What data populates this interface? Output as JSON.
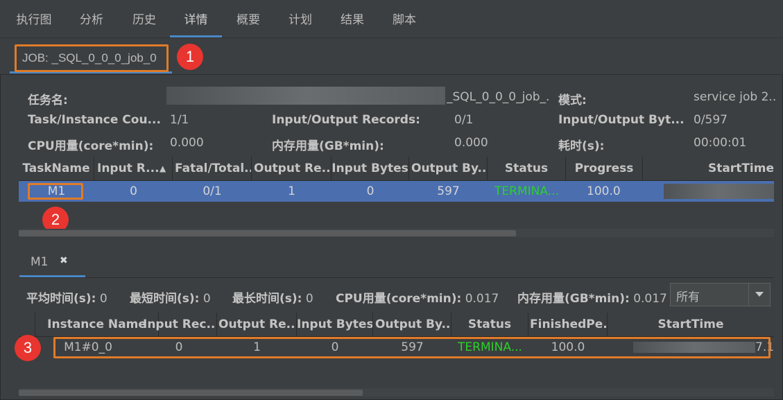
{
  "top_tabs": [
    "执行图",
    "分析",
    "历史",
    "详情",
    "概要",
    "计划",
    "结果",
    "脚本"
  ],
  "active_top_tab": "详情",
  "job_tab": {
    "label": "JOB: _SQL_0_0_0_job_0"
  },
  "markers": [
    "1",
    "2",
    "3"
  ],
  "job_info": {
    "task_name_label": "任务名:",
    "task_name_value": "_SQL_0_0_0_job_.",
    "mode_label": "模式:",
    "mode_value": "service job 2..",
    "task_count_label": "Task/Instance Cou...",
    "task_count_value": "1/1",
    "io_records_label": "Input/Output Records:",
    "io_records_value": "0/1",
    "io_bytes_label": "Input/Output Byt...",
    "io_bytes_value": "0/597",
    "cpu_label": "CPU用量(core*min):",
    "cpu_value": "0.000",
    "mem_label": "内存用量(GB*min):",
    "mem_value": "0.000",
    "time_label": "耗时(s):",
    "time_value": "00:00:01"
  },
  "task_table": {
    "columns": [
      "TaskName",
      "Input R...",
      "Fatal/Total...",
      "Output Re...",
      "Input Bytes",
      "Output By...",
      "Status",
      "Progress",
      "StartTime"
    ],
    "sort_indicator": "▲",
    "rows": [
      {
        "name": "M1",
        "input_records": "0",
        "fatal_total": "0/1",
        "output_records": "1",
        "input_bytes": "0",
        "output_bytes": "597",
        "status": "TERMINA...",
        "progress": "100.0"
      }
    ]
  },
  "detail_tab": {
    "label": "M1",
    "close": "✖"
  },
  "instance_stats": {
    "avg_label": "平均时间(s):",
    "avg_value": "0",
    "min_label": "最短时间(s):",
    "min_value": "0",
    "max_label": "最长时间(s):",
    "max_value": "0",
    "cpu_label": "CPU用量(core*min):",
    "cpu_value": "0.017",
    "mem_label": "内存用量(GB*min):",
    "mem_value": "0.017"
  },
  "filter_select": {
    "value": "所有"
  },
  "instance_table": {
    "columns": [
      "Instance Name",
      "Input Rec...",
      "Output Re...",
      "Input Bytes",
      "Output By...",
      "Status",
      "FinishedPe...",
      "StartTime"
    ],
    "rows": [
      {
        "name": "M1#0_0",
        "input_records": "0",
        "output_records": "1",
        "input_bytes": "0",
        "output_bytes": "597",
        "status": "TERMINA...",
        "finished": "100.0",
        "start_time_tail": "7.1"
      }
    ]
  },
  "colors": {
    "accent": "#4a88c7",
    "highlight": "#e07b28",
    "marker": "#e8352f",
    "status_ok": "#2bd12b",
    "selected_row": "#4b6eaf"
  }
}
